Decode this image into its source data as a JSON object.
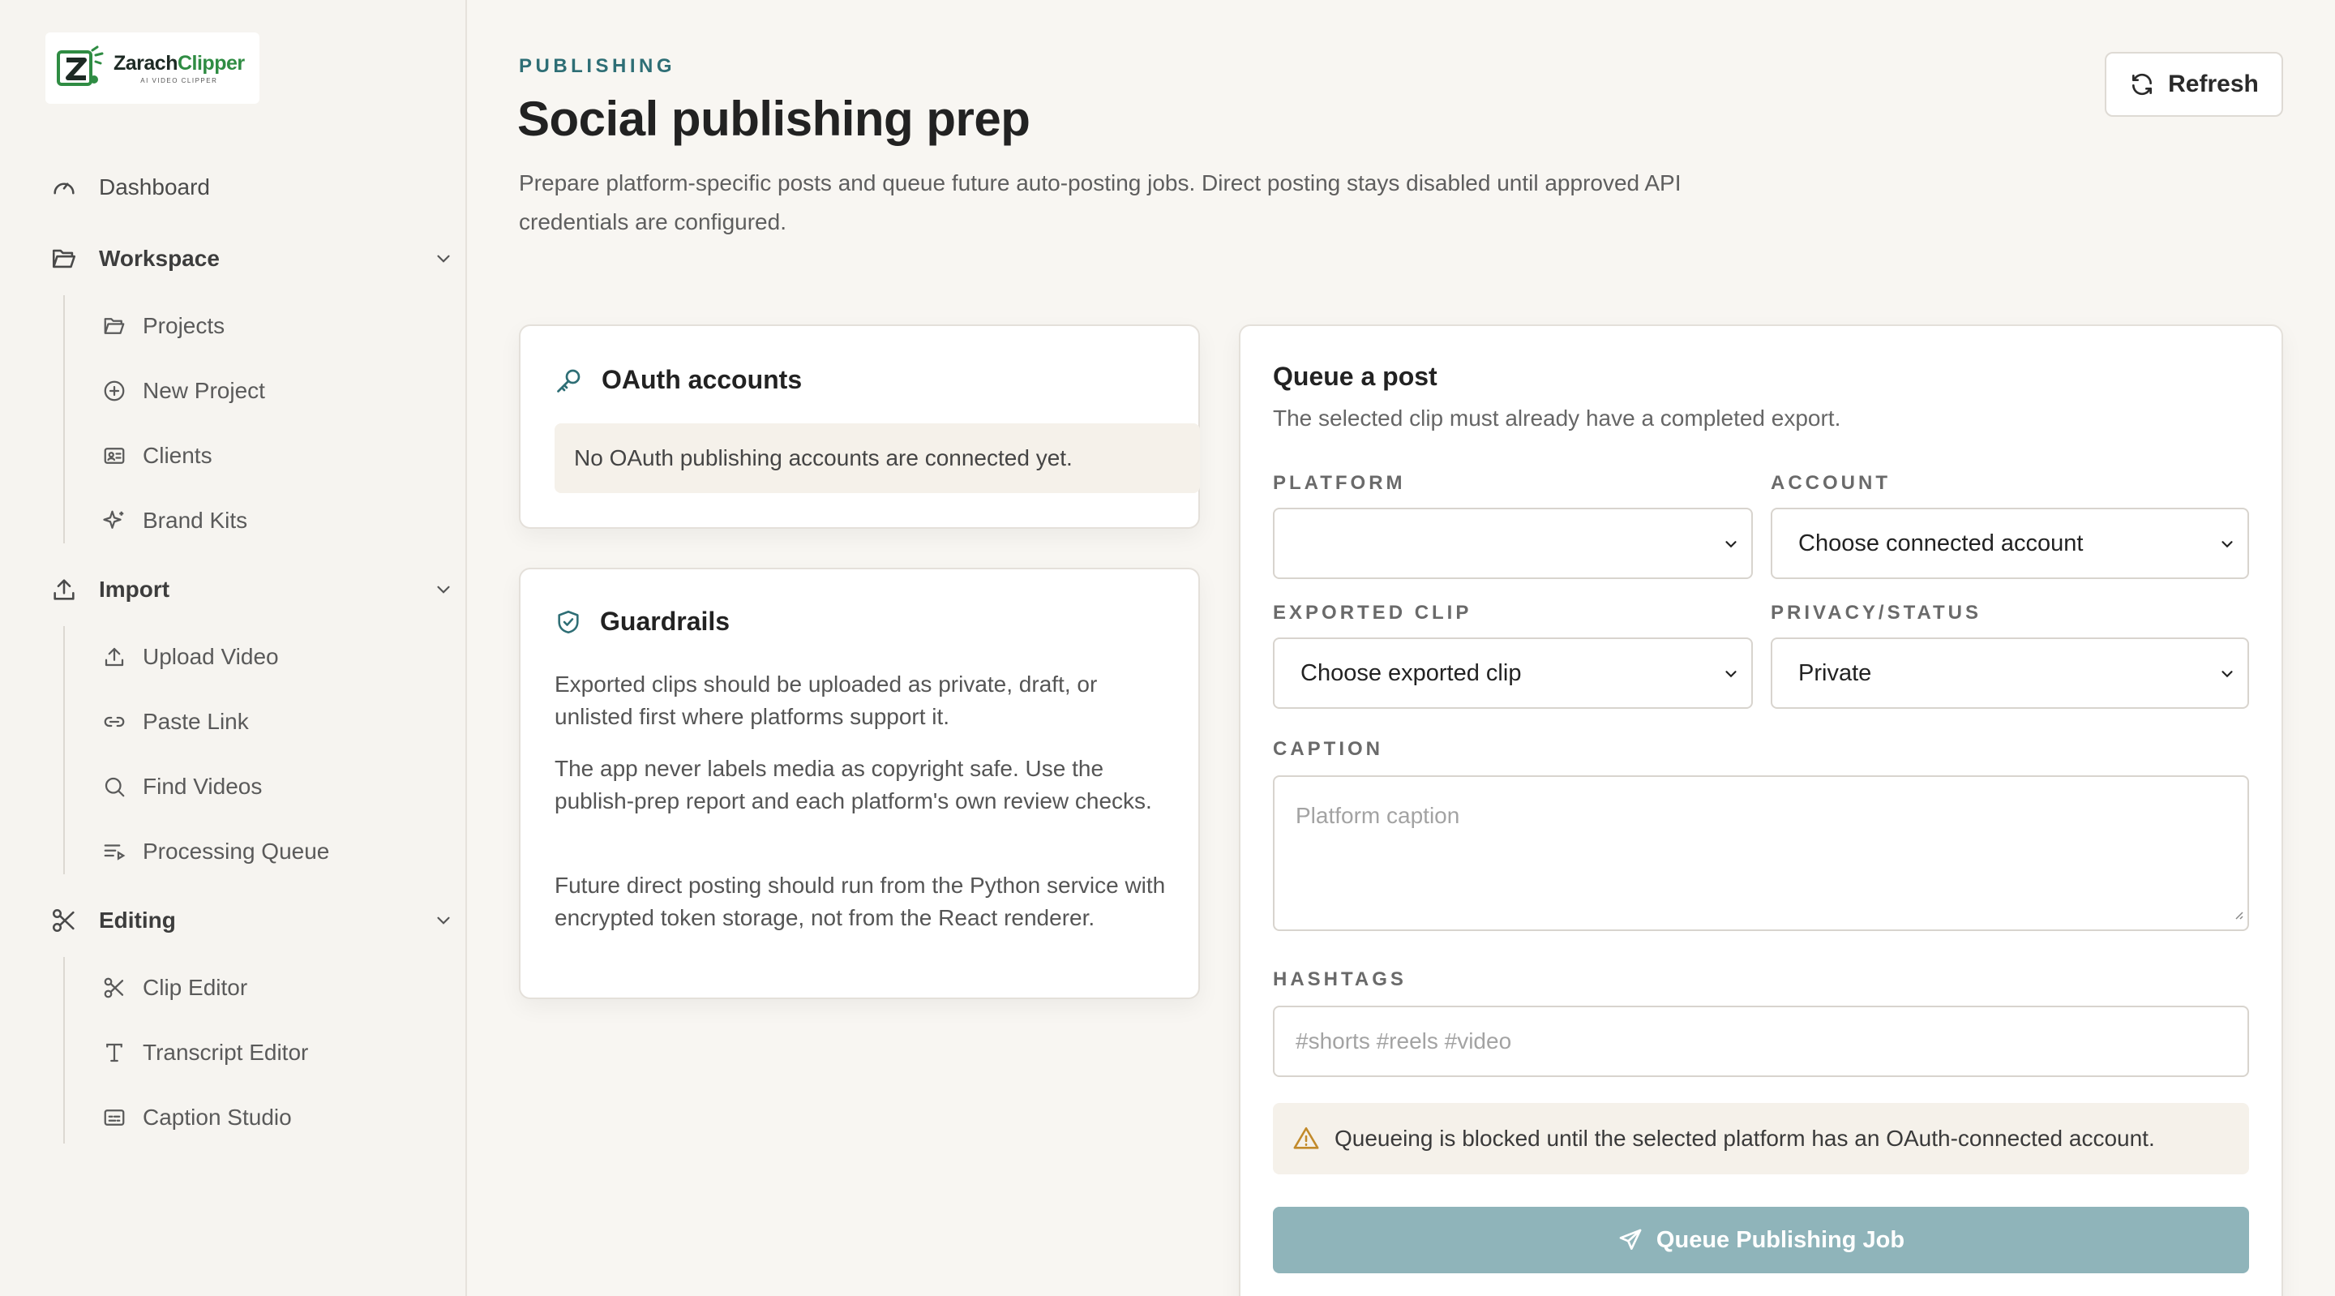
{
  "brand": {
    "name_part1": "Zarach",
    "name_part2": "Clipper",
    "tagline": "AI VIDEO CLIPPER",
    "colors": {
      "dark": "#1d2a24",
      "green": "#2f8c43"
    }
  },
  "sidebar": {
    "dashboard": {
      "label": "Dashboard",
      "icon": "gauge-icon"
    },
    "groups": [
      {
        "label": "Workspace",
        "icon": "folder-open-icon",
        "items": [
          {
            "label": "Projects",
            "icon": "folder-open-icon"
          },
          {
            "label": "New Project",
            "icon": "plus-circle-icon"
          },
          {
            "label": "Clients",
            "icon": "id-card-icon"
          },
          {
            "label": "Brand Kits",
            "icon": "sparkles-icon"
          }
        ]
      },
      {
        "label": "Import",
        "icon": "upload-icon",
        "items": [
          {
            "label": "Upload Video",
            "icon": "upload-icon"
          },
          {
            "label": "Paste Link",
            "icon": "link-icon"
          },
          {
            "label": "Find Videos",
            "icon": "search-icon"
          },
          {
            "label": "Processing Queue",
            "icon": "list-play-icon"
          }
        ]
      },
      {
        "label": "Editing",
        "icon": "scissors-icon",
        "items": [
          {
            "label": "Clip Editor",
            "icon": "scissors-icon"
          },
          {
            "label": "Transcript Editor",
            "icon": "type-icon"
          },
          {
            "label": "Caption Studio",
            "icon": "captions-icon"
          }
        ]
      }
    ]
  },
  "header": {
    "eyebrow": "PUBLISHING",
    "title": "Social publishing prep",
    "description": "Prepare platform-specific posts and queue future auto-posting jobs. Direct posting stays disabled until approved API credentials are configured.",
    "refresh_label": "Refresh",
    "accent": "#2e6e75"
  },
  "oauth": {
    "title": "OAuth accounts",
    "empty": "No OAuth publishing accounts are connected yet."
  },
  "guardrails": {
    "title": "Guardrails",
    "paragraphs": [
      "Exported clips should be uploaded as private, draft, or unlisted first where platforms support it.",
      "The app never labels media as copyright safe. Use the publish-prep report and each platform's own review checks.",
      "Future direct posting should run from the Python service with encrypted token storage, not from the React renderer."
    ]
  },
  "queue": {
    "title": "Queue a post",
    "subtitle": "The selected clip must already have a completed export.",
    "platform": {
      "label": "PLATFORM",
      "value": ""
    },
    "account": {
      "label": "ACCOUNT",
      "value": "Choose connected account"
    },
    "clip": {
      "label": "EXPORTED CLIP",
      "value": "Choose exported clip"
    },
    "privacy": {
      "label": "PRIVACY/STATUS",
      "value": "Private"
    },
    "caption": {
      "label": "CAPTION",
      "placeholder": "Platform caption"
    },
    "hashtags": {
      "label": "HASHTAGS",
      "placeholder": "#shorts #reels #video"
    },
    "warning": "Queueing is blocked until the selected platform has an OAuth-connected account.",
    "submit_label": "Queue Publishing Job",
    "colors": {
      "button": "#8fb4ba",
      "warning_icon": "#c28a2a"
    }
  }
}
